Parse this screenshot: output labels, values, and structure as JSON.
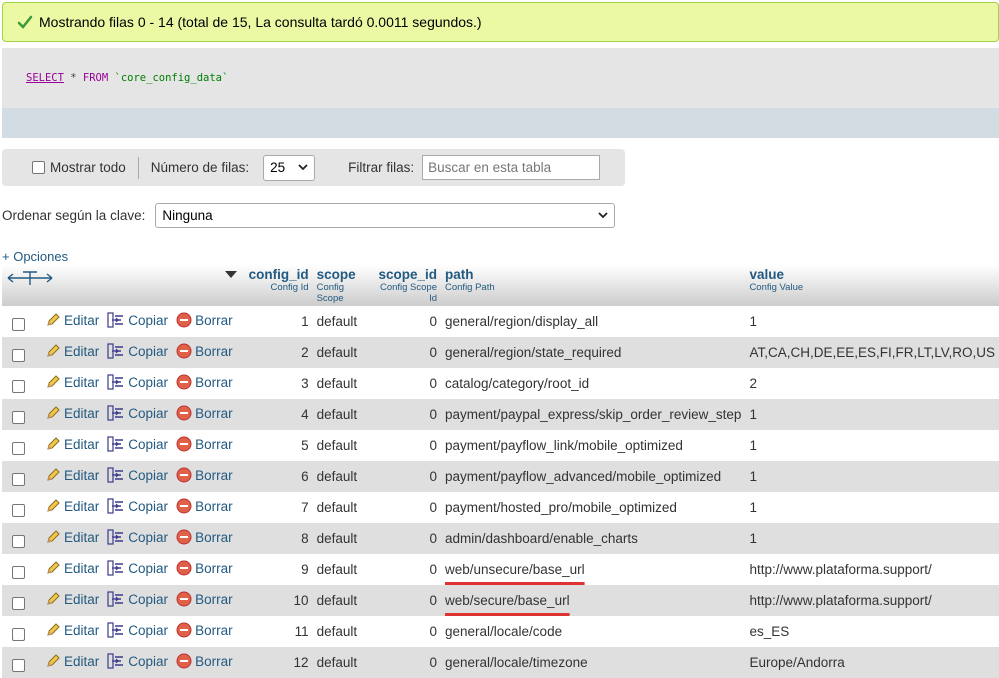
{
  "success_message": "Mostrando filas 0 - 14 (total de 15, La consulta tardó 0.0011 segundos.)",
  "sql": {
    "select": "SELECT",
    "star": " * ",
    "from": "FROM",
    "table": " `core_config_data`"
  },
  "toolbar": {
    "show_all_label": "Mostrar todo",
    "rows_label": "Número de filas:",
    "rows_value": "25",
    "filter_label": "Filtrar filas:",
    "filter_placeholder": "Buscar en esta tabla"
  },
  "sort": {
    "label": "Ordenar según la clave:",
    "value": "Ninguna"
  },
  "options_link": "+ Opciones",
  "columns": [
    {
      "name": "config_id",
      "comment": "Config Id"
    },
    {
      "name": "scope",
      "comment": "Config Scope"
    },
    {
      "name": "scope_id",
      "comment": "Config Scope Id"
    },
    {
      "name": "path",
      "comment": "Config Path"
    },
    {
      "name": "value",
      "comment": "Config Value"
    }
  ],
  "actions": {
    "edit": "Editar",
    "copy": "Copiar",
    "delete": "Borrar"
  },
  "rows": [
    {
      "config_id": "1",
      "scope": "default",
      "scope_id": "0",
      "path": "general/region/display_all",
      "value": "1"
    },
    {
      "config_id": "2",
      "scope": "default",
      "scope_id": "0",
      "path": "general/region/state_required",
      "value": "AT,CA,CH,DE,EE,ES,FI,FR,LT,LV,RO,US"
    },
    {
      "config_id": "3",
      "scope": "default",
      "scope_id": "0",
      "path": "catalog/category/root_id",
      "value": "2"
    },
    {
      "config_id": "4",
      "scope": "default",
      "scope_id": "0",
      "path": "payment/paypal_express/skip_order_review_step",
      "value": "1"
    },
    {
      "config_id": "5",
      "scope": "default",
      "scope_id": "0",
      "path": "payment/payflow_link/mobile_optimized",
      "value": "1"
    },
    {
      "config_id": "6",
      "scope": "default",
      "scope_id": "0",
      "path": "payment/payflow_advanced/mobile_optimized",
      "value": "1"
    },
    {
      "config_id": "7",
      "scope": "default",
      "scope_id": "0",
      "path": "payment/hosted_pro/mobile_optimized",
      "value": "1"
    },
    {
      "config_id": "8",
      "scope": "default",
      "scope_id": "0",
      "path": "admin/dashboard/enable_charts",
      "value": "1"
    },
    {
      "config_id": "9",
      "scope": "default",
      "scope_id": "0",
      "path": "web/unsecure/base_url",
      "value": "http://www.plataforma.support/",
      "highlight": true
    },
    {
      "config_id": "10",
      "scope": "default",
      "scope_id": "0",
      "path": "web/secure/base_url",
      "value": "http://www.plataforma.support/",
      "highlight": true
    },
    {
      "config_id": "11",
      "scope": "default",
      "scope_id": "0",
      "path": "general/locale/code",
      "value": "es_ES"
    },
    {
      "config_id": "12",
      "scope": "default",
      "scope_id": "0",
      "path": "general/locale/timezone",
      "value": "Europe/Andorra"
    }
  ],
  "colors": {
    "success_bg": "#ebf8a4",
    "link": "#235a81",
    "row_alt": "#dfdfdf",
    "underline": "#dd3333"
  }
}
